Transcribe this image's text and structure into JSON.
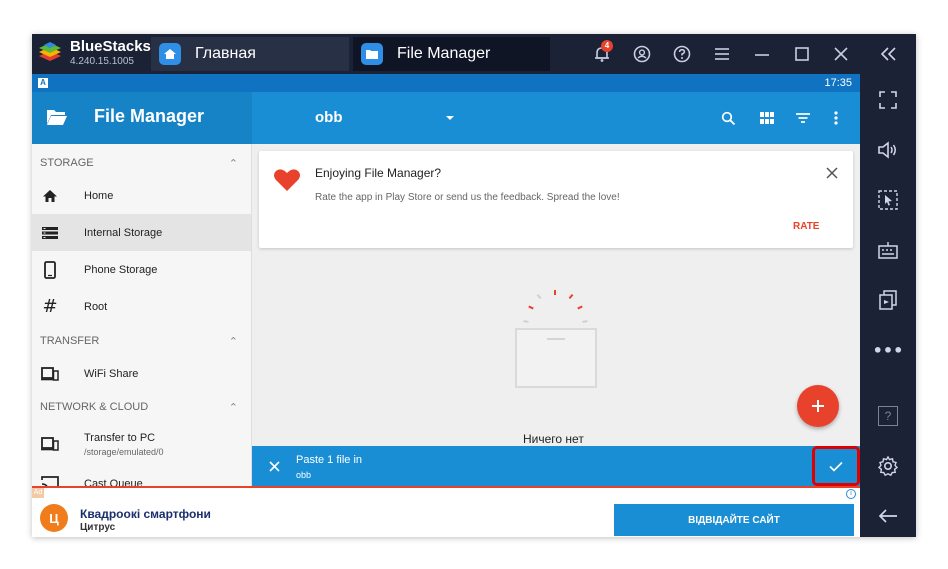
{
  "emulator": {
    "name": "BlueStacks",
    "version": "4.240.15.1005",
    "tabs": [
      {
        "label": "Главная",
        "icon": "home-icon"
      },
      {
        "label": "File Manager",
        "icon": "folder-icon"
      }
    ],
    "notification_count": "4",
    "controls": [
      "bell-icon",
      "account-icon",
      "help-icon",
      "menu-icon",
      "minimize-icon",
      "maximize-icon",
      "close-icon"
    ],
    "sidebar": [
      "collapse-icon",
      "fullscreen-icon",
      "volume-icon",
      "cursor-icon",
      "keyboard-icon",
      "copy-icon",
      "more-icon",
      "help-icon",
      "settings-icon",
      "back-icon"
    ],
    "sidebar_more": "•••",
    "sidebar_help": "?"
  },
  "status_bar": {
    "badge": "A",
    "time": "17:35"
  },
  "app": {
    "title": "File Manager",
    "current_path": "obb",
    "actions": [
      "search-icon",
      "grid-icon",
      "filter-icon",
      "more-vert-icon"
    ]
  },
  "drawer": {
    "sections": [
      {
        "label": "STORAGE"
      },
      {
        "label": "TRANSFER"
      },
      {
        "label": "NETWORK & CLOUD"
      }
    ],
    "items": [
      {
        "label": "Home",
        "icon": "home-icon"
      },
      {
        "label": "Internal Storage",
        "icon": "storage-icon",
        "active": true
      },
      {
        "label": "Phone Storage",
        "icon": "phone-icon"
      },
      {
        "label": "Root",
        "icon": "hash-icon"
      },
      {
        "label": "WiFi Share",
        "icon": "wifi-share-icon"
      },
      {
        "label": "Transfer to PC",
        "sublabel": "/storage/emulated/0",
        "icon": "transfer-pc-icon"
      },
      {
        "label": "Cast Queue",
        "icon": "cast-icon"
      }
    ]
  },
  "rating_card": {
    "title": "Enjoying File Manager?",
    "body": "Rate the app in Play Store or send us the feedback. Spread the love!",
    "action": "RATE"
  },
  "empty_state": {
    "text": "Ничего нет"
  },
  "paste_bar": {
    "title": "Paste 1 file in",
    "target": "obb"
  },
  "ad": {
    "tag": "Ad",
    "logo_letter": "Ц",
    "title": "Квадроокі смартфони",
    "subtitle": "Цитрус",
    "button": "ВІДВІДАЙТЕ САЙТ",
    "info": "i"
  },
  "colors": {
    "accent": "#1a8ed4",
    "fab": "#e8412c",
    "highlight_border": "#e00000",
    "emulator_chrome": "#1b2235"
  }
}
